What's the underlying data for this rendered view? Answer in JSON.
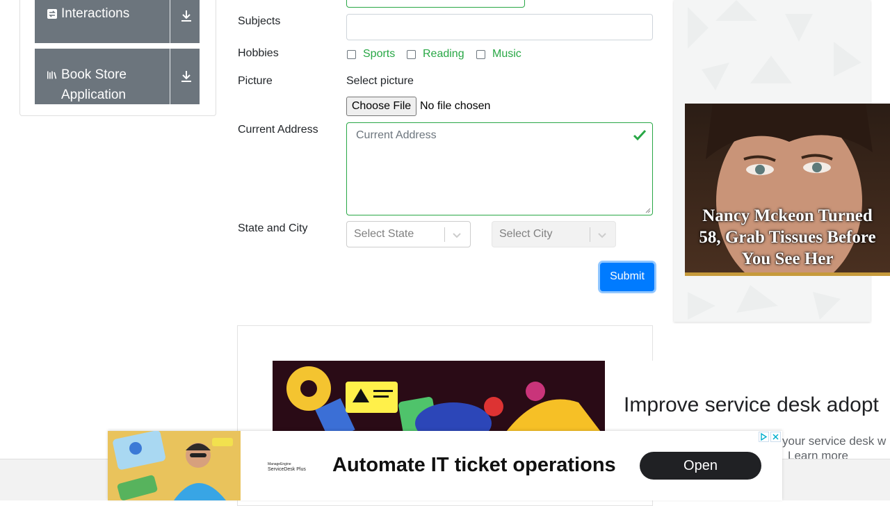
{
  "sidebar": {
    "groups": [
      {
        "label": "Interactions",
        "icon": "swap-arrows-icon"
      },
      {
        "label": "Book Store Application",
        "icon": "books-icon"
      }
    ]
  },
  "form": {
    "subjects_label": "Subjects",
    "hobbies_label": "Hobbies",
    "hobbies": [
      "Sports",
      "Reading",
      "Music"
    ],
    "picture_label": "Picture",
    "picture_sublabel": "Select picture",
    "file_button": "Choose File",
    "file_status": "No file chosen",
    "address_label": "Current Address",
    "address_placeholder": "Current Address",
    "state_city_label": "State and City",
    "state_placeholder": "Select State",
    "city_placeholder": "Select City",
    "submit_label": "Submit"
  },
  "right_ad": {
    "headline": "Nancy Mckeon Turned 58, Grab Tissues Before You See Her"
  },
  "middle_ad": {
    "headline": "Improve service desk adopt",
    "body": "your service desk w",
    "more": "Learn more"
  },
  "bottom_banner": {
    "logo_line1": "ManageEngine",
    "logo_line2": "ServiceDesk Plus",
    "text": "Automate IT ticket operations",
    "button": "Open"
  },
  "colors": {
    "accent_green": "#28a745",
    "primary_blue": "#007bff",
    "sidebar_gray": "#6c757d"
  }
}
